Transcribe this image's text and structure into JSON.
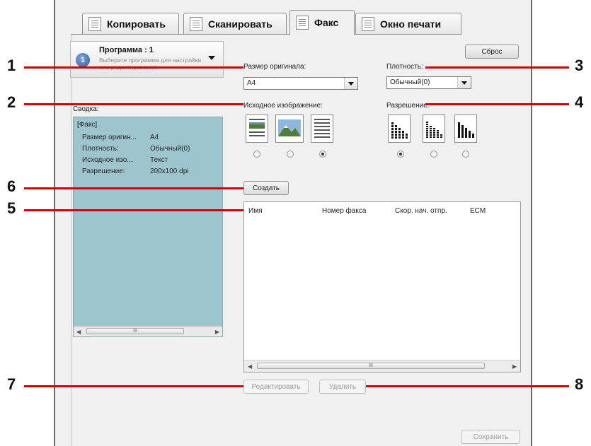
{
  "tabs": [
    {
      "label": "Копировать",
      "icon": "copy-icon"
    },
    {
      "label": "Сканировать",
      "icon": "scan-icon"
    },
    {
      "label": "Факс",
      "icon": "fax-icon"
    },
    {
      "label": "Окно печати",
      "icon": "print-window-icon"
    }
  ],
  "active_tab": "Факс",
  "program": {
    "number_badge": "1",
    "title": "Программа : 1",
    "description": "Выберите программа для настройки или редактирования."
  },
  "reset_label": "Сброс",
  "original_size": {
    "label": "Размер оригинала:",
    "value": "A4"
  },
  "density": {
    "label": "Плотность:",
    "value": "Обычный(0)"
  },
  "original_image": {
    "label": "Исходное изображение:",
    "options": [
      "text-photo-icon",
      "photo-icon",
      "text-icon"
    ],
    "selected_index": 2
  },
  "resolution": {
    "label": "Разрешение:",
    "options": [
      "resolution-high-icon",
      "resolution-medium-icon",
      "resolution-low-icon"
    ],
    "selected_index": 0
  },
  "summary": {
    "label": "Сводка:",
    "header": "[Факс]",
    "rows": [
      {
        "key": "Размер оригин...",
        "value": "A4"
      },
      {
        "key": "Плотность:",
        "value": "Обычный(0)"
      },
      {
        "key": "Исходное изо...",
        "value": "Текст"
      },
      {
        "key": "Разрешение:",
        "value": "200x100 dpi"
      }
    ],
    "scroll_glyph": "III",
    "color": "#9ec4ce"
  },
  "create_label": "Создать",
  "table": {
    "columns": [
      "Имя",
      "Номер факса",
      "Скор. нач. отпр.",
      "ECM"
    ],
    "rows": [],
    "scroll_glyph": "III"
  },
  "edit_label": "Редактировать",
  "delete_label": "Удалить",
  "save_label": "Сохранить",
  "callouts": [
    "1",
    "2",
    "3",
    "4",
    "5",
    "6",
    "7",
    "8"
  ],
  "callout_color": "#d40000"
}
